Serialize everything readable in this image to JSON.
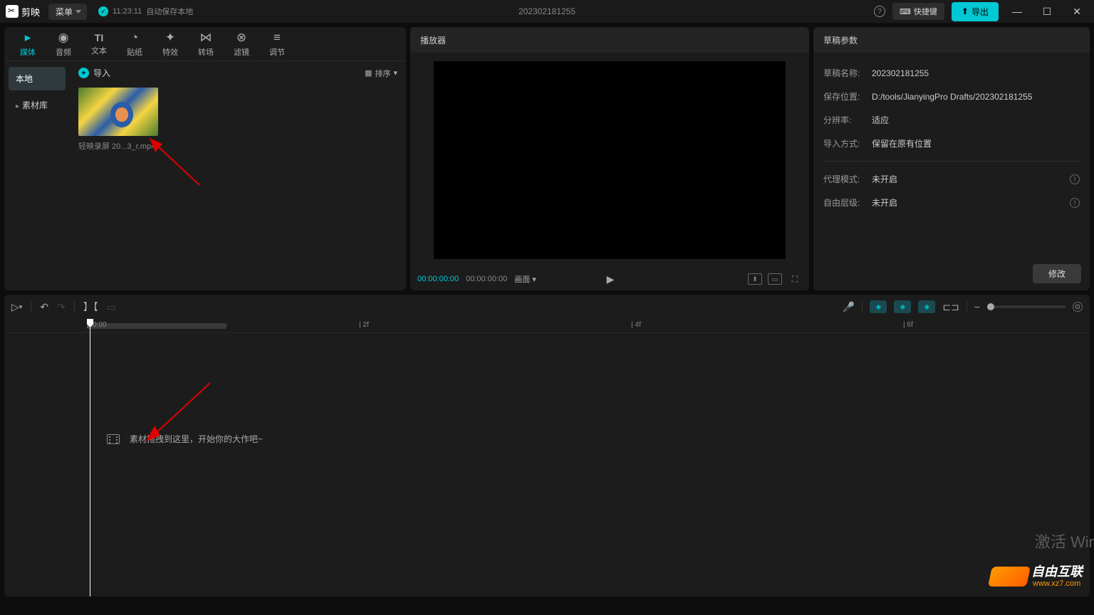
{
  "title": {
    "app_name": "剪映",
    "menu_label": "菜单",
    "autosave_time": "11:23:11",
    "autosave_text": "自动保存本地",
    "project_name": "202302181255",
    "shortcut_label": "快捷键",
    "export_label": "导出"
  },
  "media_tabs": [
    {
      "key": "media",
      "label": "媒体",
      "icon": "▸",
      "active": true
    },
    {
      "key": "audio",
      "label": "音频",
      "icon": "◉"
    },
    {
      "key": "text",
      "label": "文本",
      "icon": "TI"
    },
    {
      "key": "sticker",
      "label": "贴纸",
      "icon": "◔"
    },
    {
      "key": "effect",
      "label": "特效",
      "icon": "✦"
    },
    {
      "key": "transition",
      "label": "转场",
      "icon": "⋈"
    },
    {
      "key": "filter",
      "label": "滤镜",
      "icon": "⊗"
    },
    {
      "key": "adjust",
      "label": "调节",
      "icon": "⚙"
    }
  ],
  "media_sidebar": {
    "local": "本地",
    "library": "素材库"
  },
  "media": {
    "import_label": "导入",
    "sort_label": "排序",
    "sort_icon": "▦",
    "item_name": "轻映录屏 20...3_r.mp4"
  },
  "player": {
    "header": "播放器",
    "time_current": "00:00:00:00",
    "time_total": "00:00:00:00",
    "ratio_label": "画面"
  },
  "props": {
    "header": "草稿参数",
    "rows": {
      "name_label": "草稿名称:",
      "name_value": "202302181255",
      "path_label": "保存位置:",
      "path_value": "D:/tools/JianyingPro Drafts/202302181255",
      "res_label": "分辨率:",
      "res_value": "适应",
      "import_label": "导入方式:",
      "import_value": "保留在原有位置",
      "proxy_label": "代理模式:",
      "proxy_value": "未开启",
      "layer_label": "自由层级:",
      "layer_value": "未开启"
    },
    "modify": "修改"
  },
  "timeline": {
    "start_label": "|00:00",
    "marks": [
      "2f",
      "4f",
      "6f"
    ],
    "empty_text": "素材拖拽到这里，开始你的大作吧~"
  },
  "footer": {
    "activate": "激活 Wir",
    "watermark_main": "自由互联",
    "watermark_sub": "www.xz7.com"
  }
}
